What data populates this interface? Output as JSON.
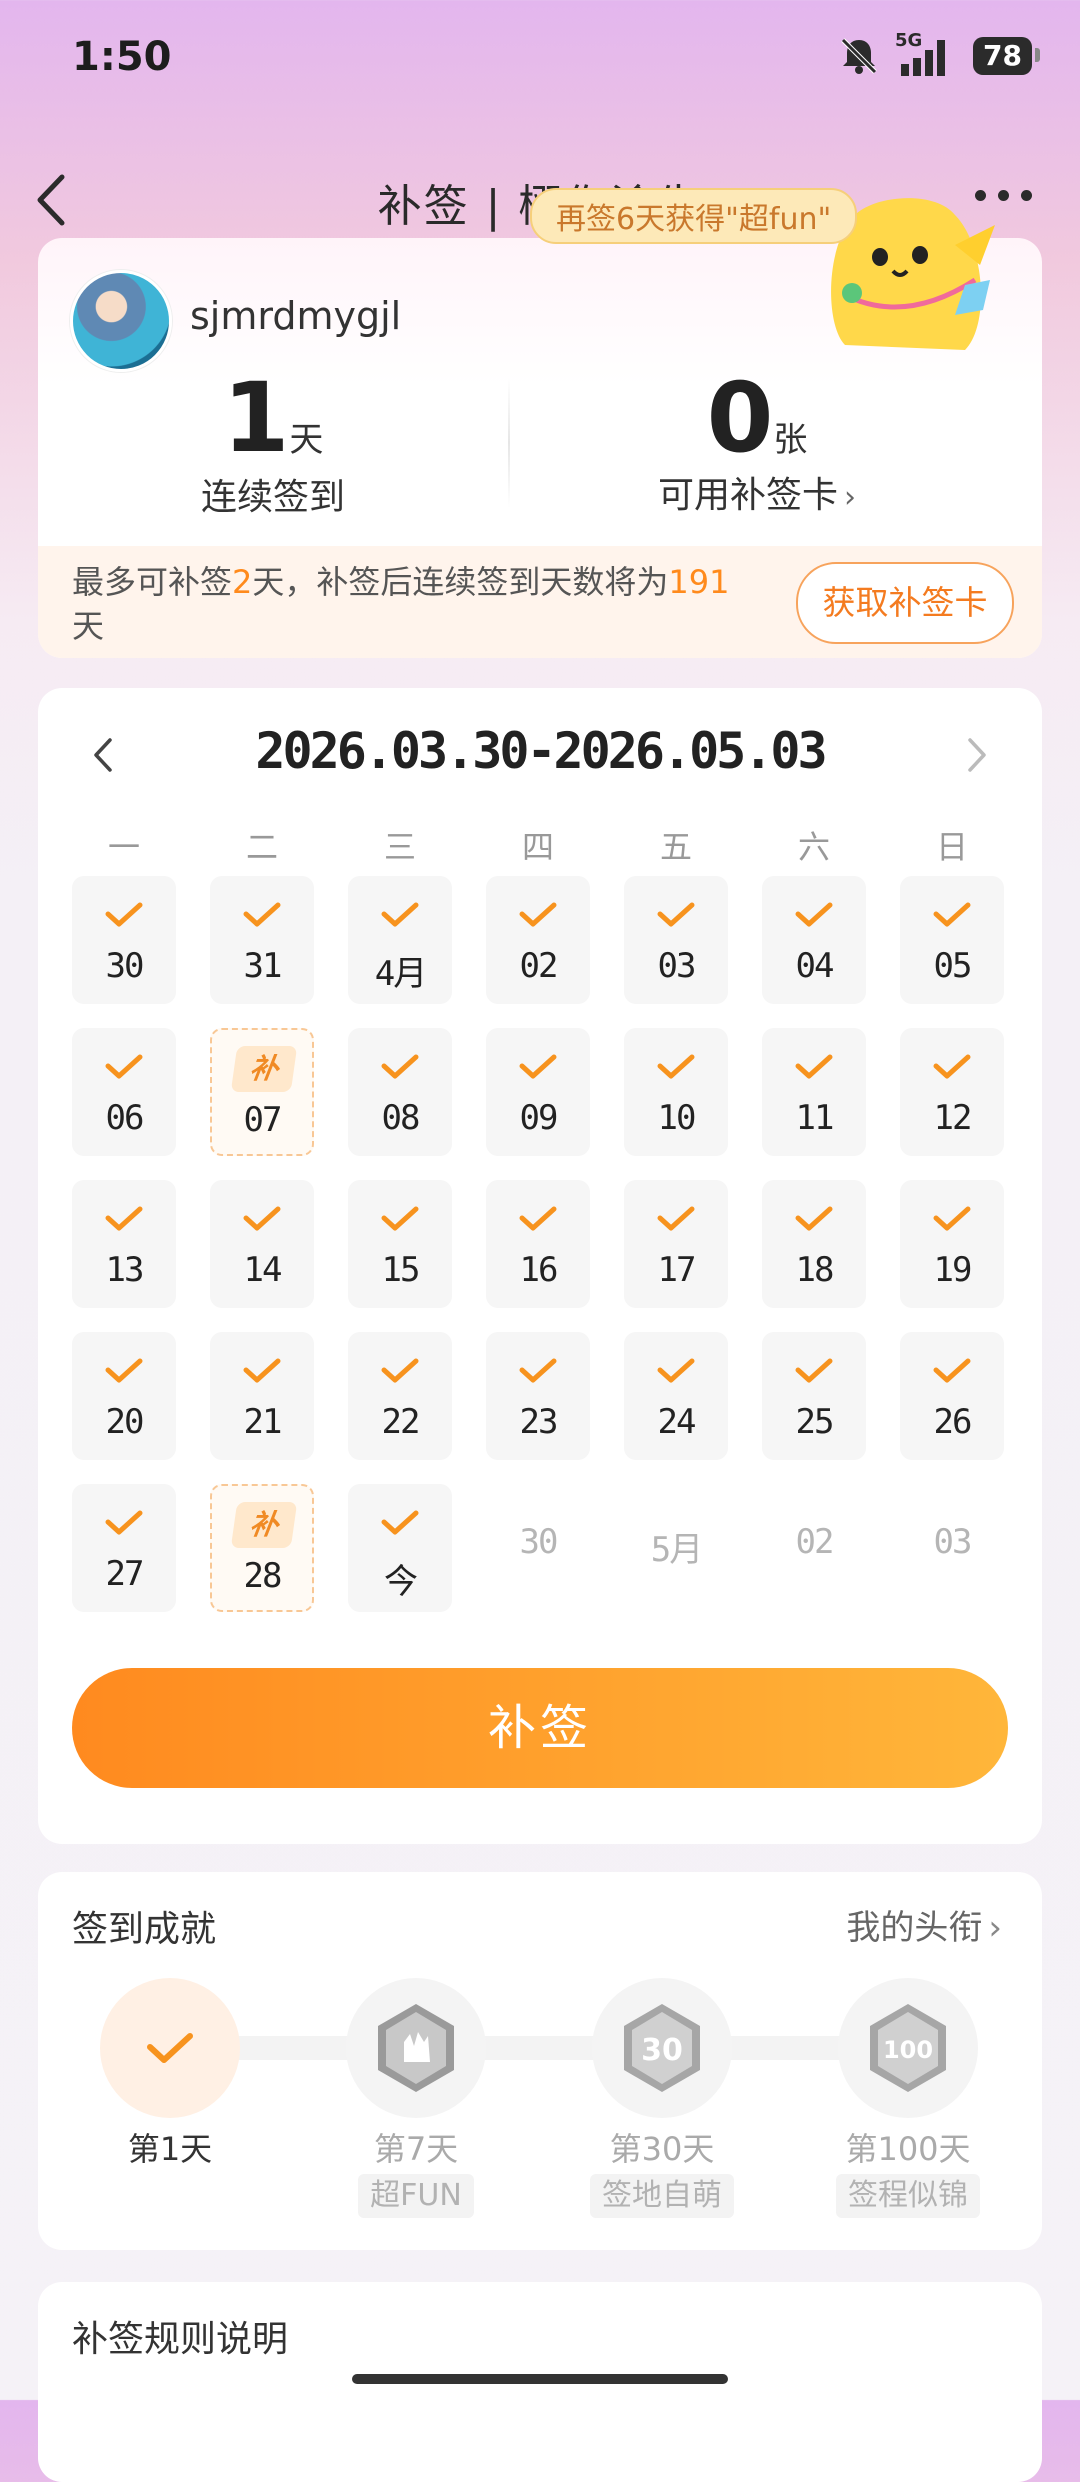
{
  "status_bar": {
    "time": "1:50",
    "network": "5G",
    "battery": "78"
  },
  "header": {
    "title": "补签 | 栩你渝生",
    "bubble": "再签6天获得\"超fun\""
  },
  "profile": {
    "username": "sjmrdmygjl",
    "streak_value": "1",
    "streak_unit": "天",
    "streak_label": "连续签到",
    "cards_value": "0",
    "cards_unit": "张",
    "cards_label": "可用补签卡"
  },
  "notice": {
    "part1": "最多可补签",
    "max_days": "2",
    "part2": "天，补签后连续签到天数将为",
    "result_days": "191",
    "part3": "天",
    "button": "获取补签卡"
  },
  "calendar": {
    "range": "2026.03.30-2026.05.03",
    "weekdays": [
      "一",
      "二",
      "三",
      "四",
      "五",
      "六",
      "日"
    ],
    "days": [
      {
        "label": "30",
        "state": "signed"
      },
      {
        "label": "31",
        "state": "signed"
      },
      {
        "label": "4月",
        "state": "signed"
      },
      {
        "label": "02",
        "state": "signed"
      },
      {
        "label": "03",
        "state": "signed"
      },
      {
        "label": "04",
        "state": "signed"
      },
      {
        "label": "05",
        "state": "signed"
      },
      {
        "label": "06",
        "state": "signed"
      },
      {
        "label": "07",
        "state": "makeup"
      },
      {
        "label": "08",
        "state": "signed"
      },
      {
        "label": "09",
        "state": "signed"
      },
      {
        "label": "10",
        "state": "signed"
      },
      {
        "label": "11",
        "state": "signed"
      },
      {
        "label": "12",
        "state": "signed"
      },
      {
        "label": "13",
        "state": "signed"
      },
      {
        "label": "14",
        "state": "signed"
      },
      {
        "label": "15",
        "state": "signed"
      },
      {
        "label": "16",
        "state": "signed"
      },
      {
        "label": "17",
        "state": "signed"
      },
      {
        "label": "18",
        "state": "signed"
      },
      {
        "label": "19",
        "state": "signed"
      },
      {
        "label": "20",
        "state": "signed"
      },
      {
        "label": "21",
        "state": "signed"
      },
      {
        "label": "22",
        "state": "signed"
      },
      {
        "label": "23",
        "state": "signed"
      },
      {
        "label": "24",
        "state": "signed"
      },
      {
        "label": "25",
        "state": "signed"
      },
      {
        "label": "26",
        "state": "signed"
      },
      {
        "label": "27",
        "state": "signed"
      },
      {
        "label": "28",
        "state": "makeup"
      },
      {
        "label": "今",
        "state": "signed"
      },
      {
        "label": "30",
        "state": "future"
      },
      {
        "label": "5月",
        "state": "future"
      },
      {
        "label": "02",
        "state": "future"
      },
      {
        "label": "03",
        "state": "future"
      }
    ],
    "makeup_tag": "补",
    "makeup_button": "补签"
  },
  "achievements": {
    "title": "签到成就",
    "link": "我的头衔",
    "items": [
      {
        "day": "第1天",
        "badge": "",
        "done": true
      },
      {
        "day": "第7天",
        "badge": "超FUN",
        "done": false
      },
      {
        "day": "第30天",
        "badge": "签地自萌",
        "done": false
      },
      {
        "day": "第100天",
        "badge": "签程似锦",
        "done": false
      }
    ]
  },
  "rules": {
    "title": "补签规则说明"
  },
  "colors": {
    "accent": "#ff8a1f",
    "accent_light": "#ffb63a",
    "check": "#f7931e"
  }
}
